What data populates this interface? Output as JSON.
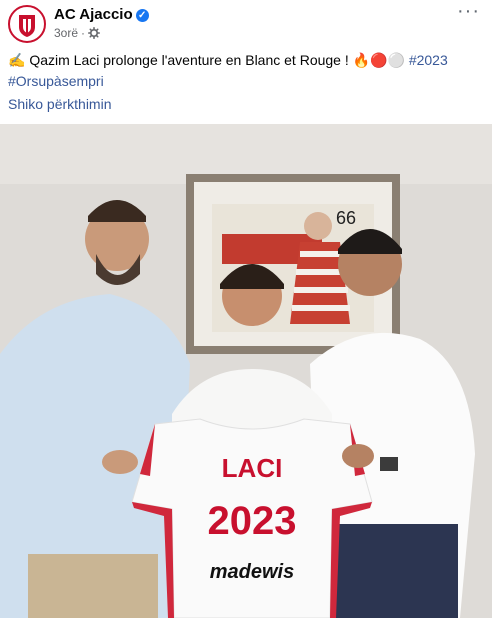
{
  "post": {
    "page_name": "AC Ajaccio",
    "time": "3orë",
    "privacy_icon": "gear-icon",
    "more_icon": "more-dots-icon",
    "text_emoji_start": "✍️",
    "text": "Qazim Laci prolonge l'aventure en Blanc et Rouge !",
    "text_emojis": "🔥🔴⚪",
    "hashtag_1": "#2023",
    "hashtag_2": "#Orsupàsempri",
    "see_translation": "Shiko përkthimin"
  },
  "photo": {
    "jersey_name": "LACI",
    "jersey_number": "2023",
    "jersey_sponsor": "madewis",
    "frame_number": "66"
  },
  "colors": {
    "link": "#385898",
    "verified": "#1877f2",
    "club_red": "#c8102e"
  }
}
